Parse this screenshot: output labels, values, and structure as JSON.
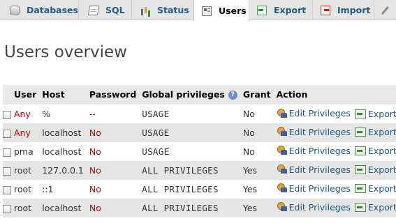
{
  "tabs": [
    {
      "label": "Databases",
      "icon": "database-icon"
    },
    {
      "label": "SQL",
      "icon": "sql-icon"
    },
    {
      "label": "Status",
      "icon": "status-icon"
    },
    {
      "label": "Users",
      "icon": "users-icon",
      "active": true
    },
    {
      "label": "Export",
      "icon": "export-icon"
    },
    {
      "label": "Import",
      "icon": "import-icon"
    },
    {
      "label": "",
      "icon": "wrench-icon"
    }
  ],
  "page_title": "Users overview",
  "table": {
    "headers": {
      "user": "User",
      "host": "Host",
      "password": "Password",
      "global_privileges": "Global privileges",
      "grant": "Grant",
      "action": "Action"
    },
    "help_glyph": "?",
    "rows": [
      {
        "user": "Any",
        "user_color": "#cc0000",
        "host": "%",
        "password": "--",
        "password_color": "#333333",
        "privileges": "USAGE",
        "grant": "No",
        "edit": "Edit Privileges",
        "export": "Export"
      },
      {
        "user": "Any",
        "user_color": "#cc0000",
        "host": "localhost",
        "password": "No",
        "password_color": "#cc0000",
        "privileges": "USAGE",
        "grant": "No",
        "edit": "Edit Privileges",
        "export": "Export"
      },
      {
        "user": "pma",
        "user_color": "#333333",
        "host": "localhost",
        "password": "No",
        "password_color": "#cc0000",
        "privileges": "USAGE",
        "grant": "No",
        "edit": "Edit Privileges",
        "export": "Export"
      },
      {
        "user": "root",
        "user_color": "#333333",
        "host": "127.0.0.1",
        "password": "No",
        "password_color": "#cc0000",
        "privileges": "ALL PRIVILEGES",
        "grant": "Yes",
        "edit": "Edit Privileges",
        "export": "Export"
      },
      {
        "user": "root",
        "user_color": "#333333",
        "host": "::1",
        "password": "No",
        "password_color": "#cc0000",
        "privileges": "ALL PRIVILEGES",
        "grant": "Yes",
        "edit": "Edit Privileges",
        "export": "Export"
      },
      {
        "user": "root",
        "user_color": "#333333",
        "host": "localhost",
        "password": "No",
        "password_color": "#cc0000",
        "privileges": "ALL PRIVILEGES",
        "grant": "Yes",
        "edit": "Edit Privileges",
        "export": "Export"
      }
    ]
  }
}
